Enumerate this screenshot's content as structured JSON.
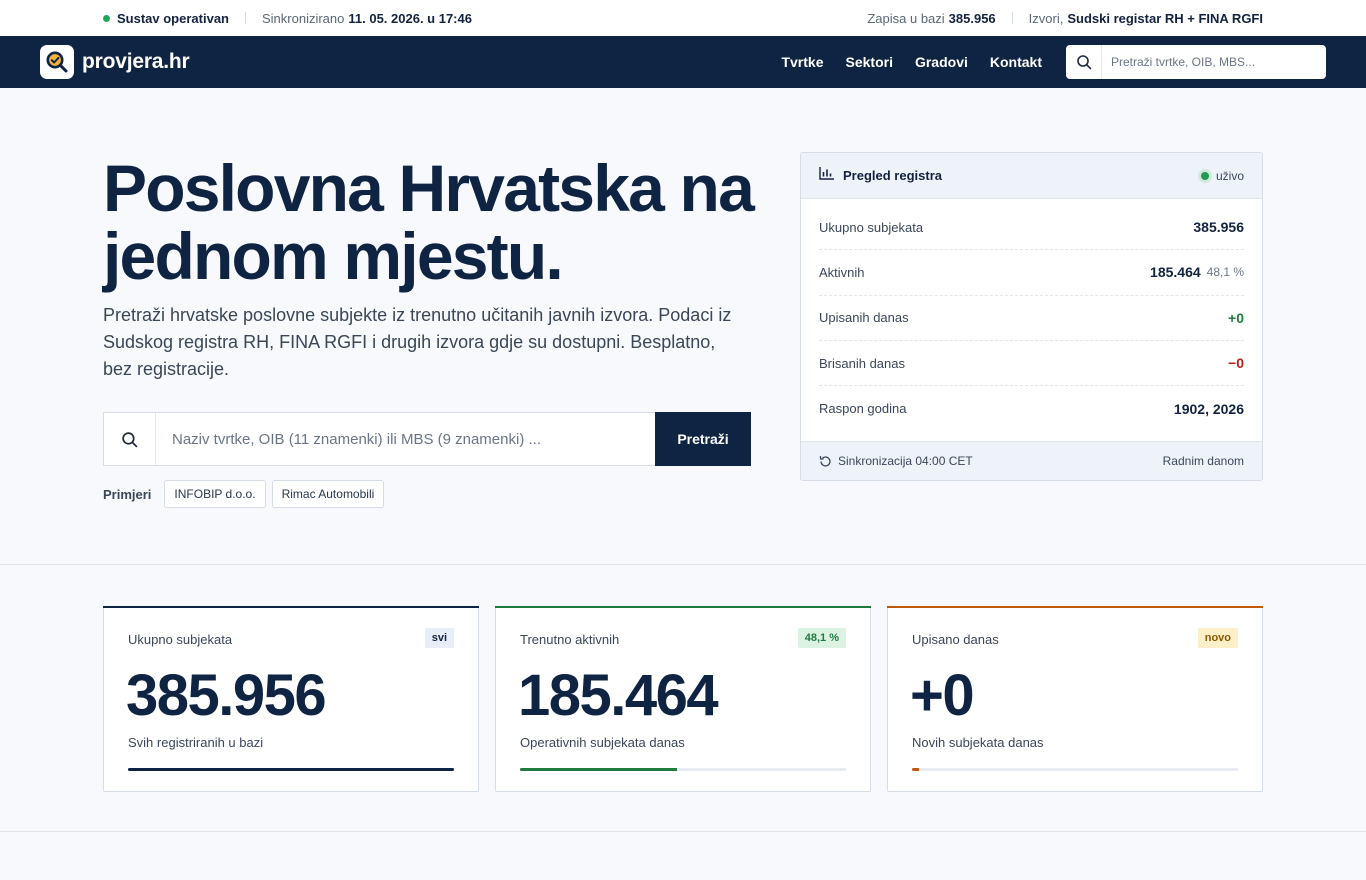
{
  "statusbar": {
    "status": "Sustav operativan",
    "sync_prefix": "Sinkronizirano",
    "sync_time": "11. 05. 2026. u 17:46",
    "records_prefix": "Zapisa u bazi",
    "records_count": "385.956",
    "sources_prefix": "Izvori,",
    "sources": "Sudski registar RH + FINA RGFI"
  },
  "nav": {
    "logo": "provjera.hr",
    "links": [
      "Tvrtke",
      "Sektori",
      "Gradovi",
      "Kontakt"
    ],
    "search_placeholder": "Pretraži tvrtke, OIB, MBS..."
  },
  "hero": {
    "title": "Poslovna Hrvatska na jednom mjestu.",
    "description": "Pretraži hrvatske poslovne subjekte iz trenutno učitanih javnih izvora. Podaci iz Sudskog registra RH, FINA RGFI i drugih izvora gdje su dostupni. Besplatno, bez registracije.",
    "search_placeholder": "Naziv tvrtke, OIB (11 znamenki) ili MBS (9 znamenki) ...",
    "search_button": "Pretraži",
    "examples_label": "Primjeri",
    "examples": [
      "INFOBIP d.o.o.",
      "Rimac Automobili"
    ]
  },
  "registry": {
    "title": "Pregled registra",
    "live": "uživo",
    "rows": [
      {
        "label": "Ukupno subjekata",
        "value": "385.956",
        "sub": ""
      },
      {
        "label": "Aktivnih",
        "value": "185.464",
        "sub": "48,1 %"
      },
      {
        "label": "Upisanih danas",
        "value": "+0",
        "sub": ""
      },
      {
        "label": "Brisanih danas",
        "value": "−0",
        "sub": ""
      },
      {
        "label": "Raspon godina",
        "value": "1902, 2026",
        "sub": ""
      }
    ],
    "footer_left": "Sinkronizacija 04:00 CET",
    "footer_right": "Radnim danom"
  },
  "stats": [
    {
      "label": "Ukupno subjekata",
      "badge": "svi",
      "value": "385.956",
      "caption": "Svih registriranih u bazi",
      "progress": 1.0,
      "accent": "#0f2443",
      "badge_bg": "#e8eef7",
      "badge_fg": "#0f2443"
    },
    {
      "label": "Trenutno aktivnih",
      "badge": "48,1 %",
      "value": "185.464",
      "caption": "Operativnih subjekata danas",
      "progress": 0.481,
      "accent": "#1f7a3f",
      "badge_bg": "#dcf3e4",
      "badge_fg": "#1f7a3f"
    },
    {
      "label": "Upisano danas",
      "badge": "novo",
      "value": "+0",
      "caption": "Novih subjekata danas",
      "progress": 0.02,
      "accent": "#c25a0b",
      "badge_bg": "#fdf0c9",
      "badge_fg": "#8a5a00"
    }
  ],
  "colors": {
    "navy": "#0f2443",
    "green": "#1f7a3f",
    "red": "#b42318",
    "orange": "#c25a0b"
  }
}
